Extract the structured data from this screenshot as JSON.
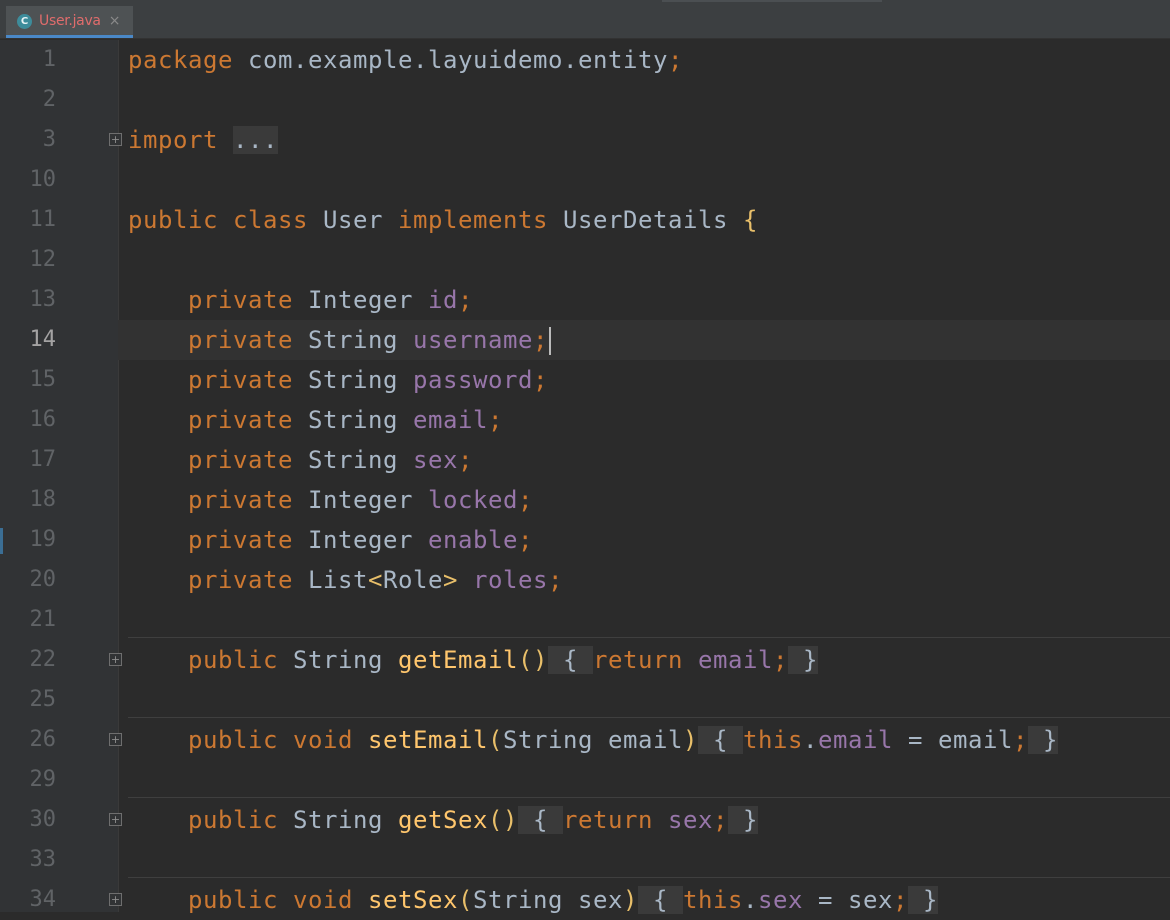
{
  "tab": {
    "icon_letter": "C",
    "title": "User.java",
    "close": "×"
  },
  "line_numbers": [
    "1",
    "2",
    "3",
    "10",
    "11",
    "12",
    "13",
    "14",
    "15",
    "16",
    "17",
    "18",
    "19",
    "20",
    "21",
    "22",
    "25",
    "26",
    "29",
    "30",
    "33",
    "34"
  ],
  "code": {
    "package_kw": "package",
    "package_name": "com.example.layuidemo.entity",
    "semi": ";",
    "import_kw": "import",
    "import_fold": "...",
    "public": "public",
    "class": "class",
    "class_name": "User",
    "implements": "implements",
    "interface": "UserDetails",
    "lbrace": "{",
    "rbrace": "}",
    "private": "private",
    "fields": [
      {
        "type": "Integer",
        "name": "id"
      },
      {
        "type": "String",
        "name": "username"
      },
      {
        "type": "String",
        "name": "password"
      },
      {
        "type": "String",
        "name": "email"
      },
      {
        "type": "String",
        "name": "sex"
      },
      {
        "type": "Integer",
        "name": "locked"
      },
      {
        "type": "Integer",
        "name": "enable"
      }
    ],
    "roles_type_outer": "List",
    "roles_type_lt": "<",
    "roles_type_inner": "Role",
    "roles_type_gt": ">",
    "roles_name": "roles",
    "return": "return",
    "this": "this",
    "void": "void",
    "String": "String",
    "getEmail": "getEmail",
    "setEmail": "setEmail",
    "getSex": "getSex",
    "setSex": "setSex",
    "email": "email",
    "sex": "sex",
    "parens_empty": "()",
    "lparen": "(",
    "rparen": ")",
    "dot": ".",
    "eq": " = "
  }
}
